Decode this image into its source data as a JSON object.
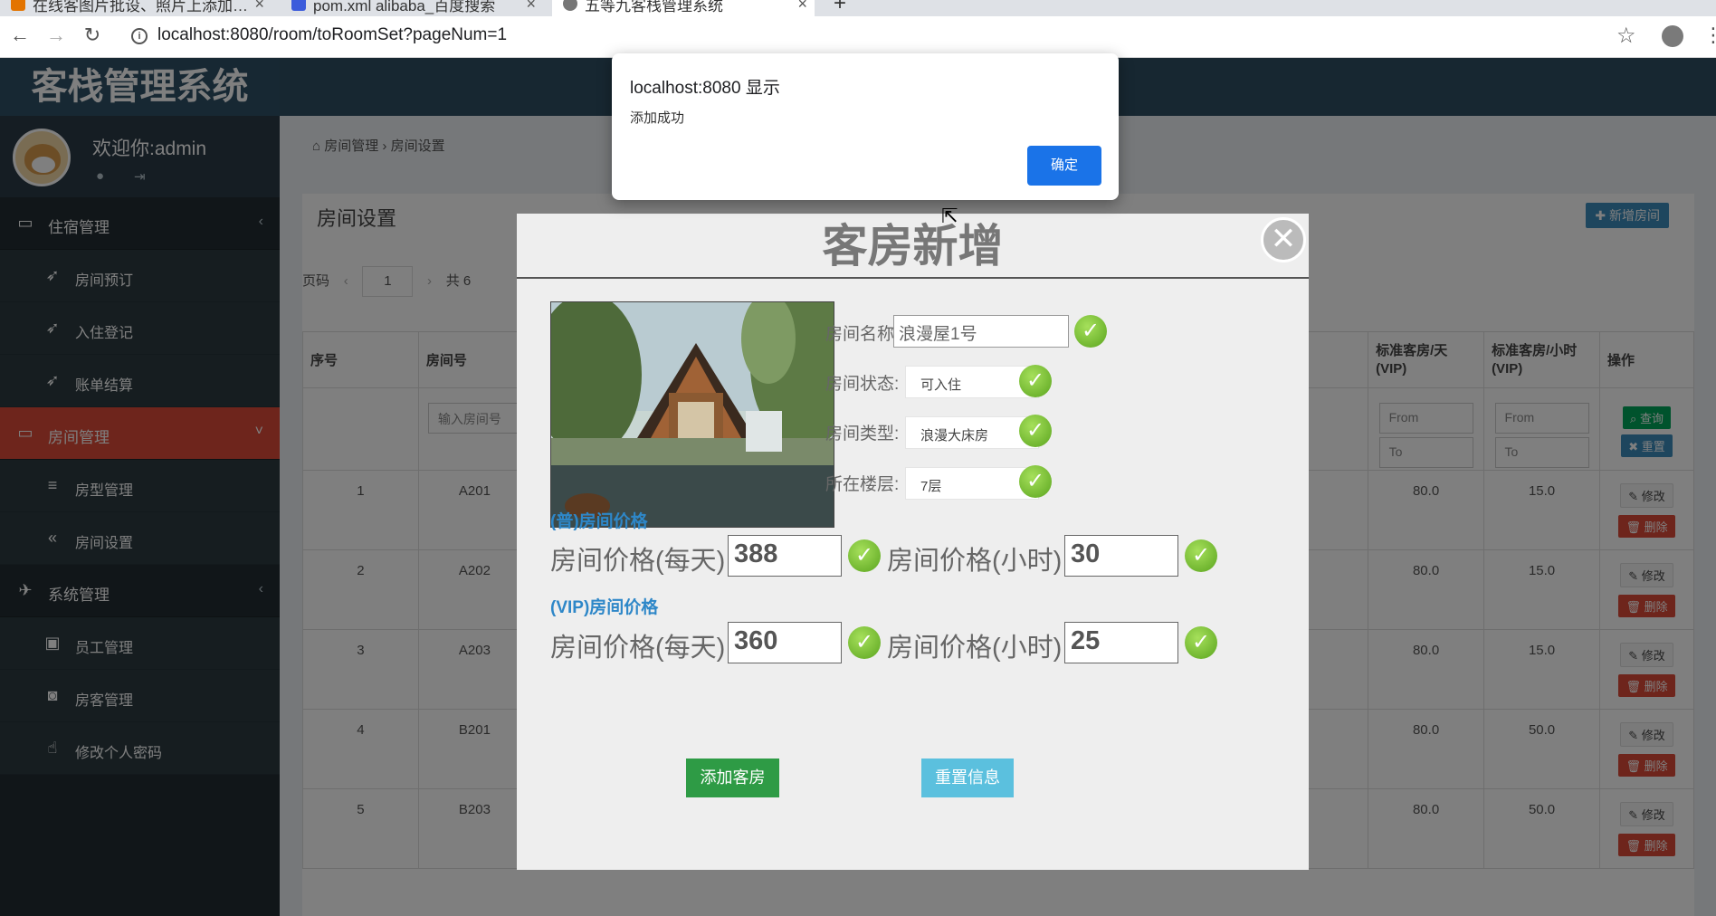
{
  "browser": {
    "tabs": [
      {
        "title": "在线客图片批设、照片上添加…",
        "color": "#e37400"
      },
      {
        "title": "pom.xml alibaba_百度搜索",
        "color": "#3b5bdb"
      },
      {
        "title": "五等九客栈管理系统",
        "color": "#777777"
      }
    ],
    "url": "localhost:8080/room/toRoomSet?pageNum=1"
  },
  "sidebar": {
    "brand": "客栈管理系统",
    "welcome": "欢迎你:admin",
    "groups": [
      {
        "label": "住宿管理",
        "icon": "laptop-icon",
        "items": [
          {
            "label": "房间预订",
            "icon": "rocket-icon"
          },
          {
            "label": "入住登记",
            "icon": "rocket-icon"
          },
          {
            "label": "账单结算",
            "icon": "rocket-icon"
          }
        ]
      },
      {
        "label": "房间管理",
        "icon": "desktop-icon",
        "items": [
          {
            "label": "房型管理",
            "icon": "list-icon"
          },
          {
            "label": "房间设置",
            "icon": "double-chevron-icon"
          }
        ]
      },
      {
        "label": "系统管理",
        "icon": "paper-plane-icon",
        "items": [
          {
            "label": "员工管理",
            "icon": "briefcase-icon"
          },
          {
            "label": "房客管理",
            "icon": "camera-icon"
          },
          {
            "label": "修改个人密码",
            "icon": "hand-pointer-icon"
          }
        ]
      }
    ]
  },
  "content": {
    "breadcrumb": "房间管理 › 房间设置",
    "box_title": "房间设置",
    "add_room": "新增房间",
    "pager_label": "页码",
    "page_input": "1",
    "pager_total": "共 6",
    "table": {
      "headers": [
        "序号",
        "房间号",
        "标准客房/天\n(VIP)",
        "标准客房/小时\n(VIP)",
        "操作"
      ],
      "room_placeholder": "输入房间号",
      "from": "From",
      "to": "To",
      "search": "查询",
      "reset": "重置",
      "edit": "修改",
      "delete": "删除",
      "rows": [
        {
          "no": "1",
          "room": "A201",
          "vip_day": "80.0",
          "vip_hour": "15.0"
        },
        {
          "no": "2",
          "room": "A202",
          "vip_day": "80.0",
          "vip_hour": "15.0"
        },
        {
          "no": "3",
          "room": "A203",
          "vip_day": "80.0",
          "vip_hour": "15.0"
        },
        {
          "no": "4",
          "room": "B201",
          "vip_day": "80.0",
          "vip_hour": "50.0"
        },
        {
          "no": "5",
          "room": "B203",
          "vip_day": "80.0",
          "vip_hour": "50.0"
        }
      ]
    }
  },
  "modal": {
    "title": "客房新增",
    "name_label": "房间名称:",
    "name_value": "浪漫屋1号",
    "status_label": "房间状态:",
    "status_value": "可入住",
    "type_label": "房间类型:",
    "type_value": "浪漫大床房",
    "floor_label": "所在楼层:",
    "floor_value": "7层",
    "normal_section": "(普)房间价格",
    "vip_section": "(VIP)房间价格",
    "day_label": "房间价格(每天):",
    "hour_label": "房间价格(小时):",
    "normal_day": "388",
    "normal_hour": "30",
    "vip_day": "360",
    "vip_hour": "25",
    "submit": "添加客房",
    "reset": "重置信息"
  },
  "alert": {
    "title": "localhost:8080 显示",
    "message": "添加成功",
    "ok": "确定"
  }
}
